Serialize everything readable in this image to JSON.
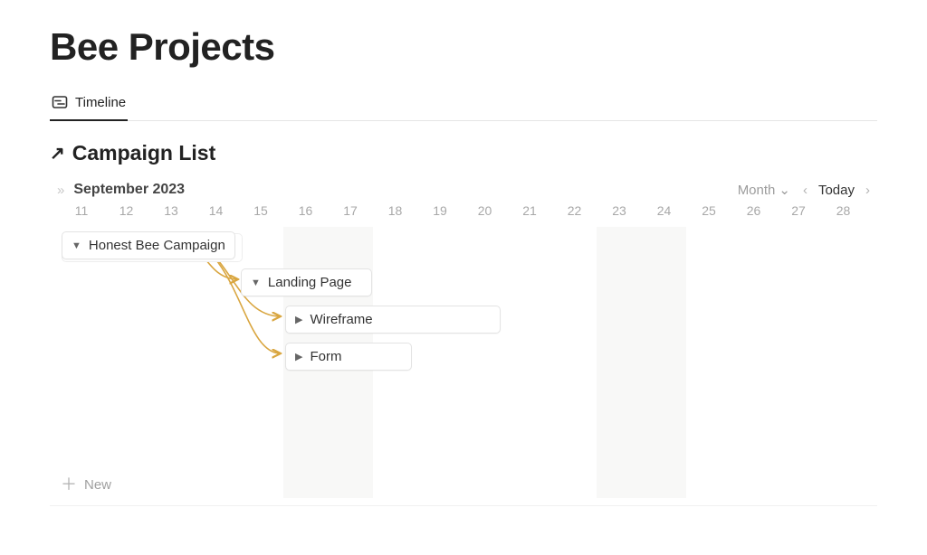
{
  "page": {
    "title": "Bee Projects"
  },
  "tabs": {
    "timeline": "Timeline"
  },
  "section": {
    "title": "Campaign List"
  },
  "toolbar": {
    "month": "September 2023",
    "scale": "Month",
    "today": "Today"
  },
  "days": [
    "11",
    "12",
    "13",
    "14",
    "15",
    "16",
    "17",
    "18",
    "19",
    "20",
    "21",
    "22",
    "23",
    "24",
    "25",
    "26",
    "27",
    "28"
  ],
  "cards": {
    "honest_bee": "Honest Bee Campaign",
    "landing_page": "Landing Page",
    "wireframe": "Wireframe",
    "form": "Form"
  },
  "actions": {
    "new": "New"
  }
}
